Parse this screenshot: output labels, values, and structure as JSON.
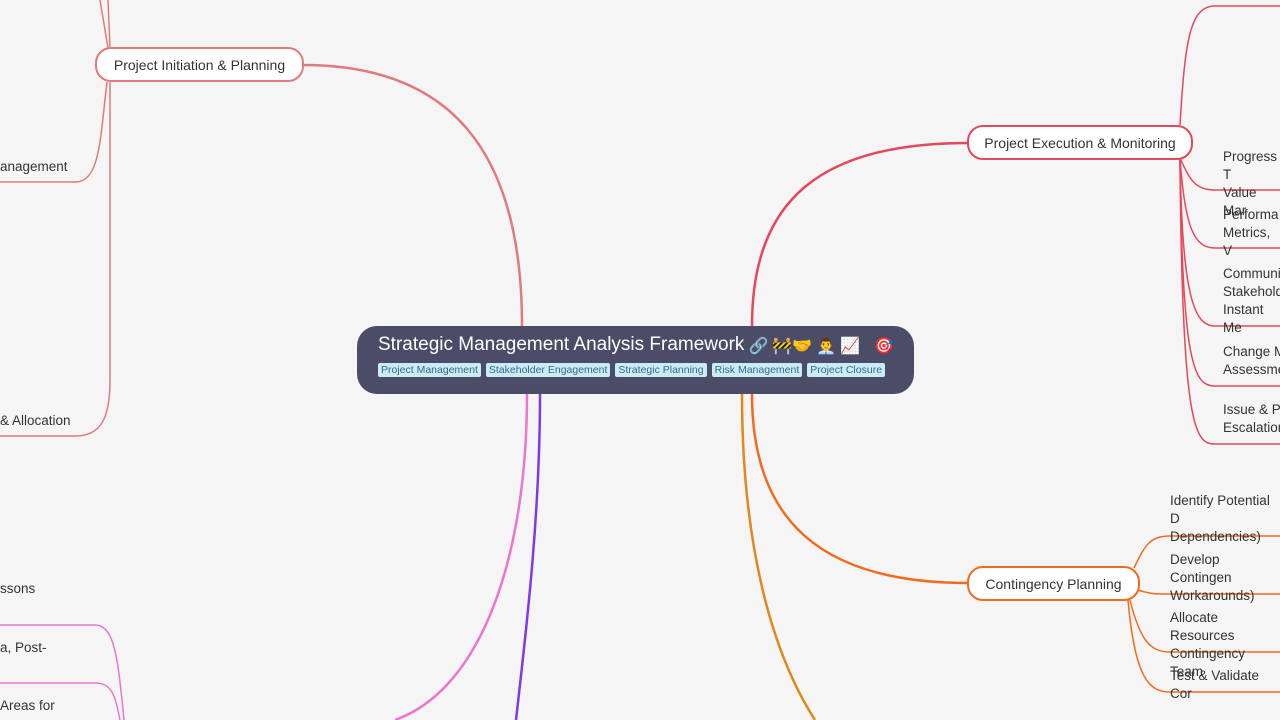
{
  "root": {
    "title": "Strategic Management Analysis Framework",
    "icons": [
      {
        "name": "link-icon",
        "glyph": "🔗"
      },
      {
        "name": "construction-icon",
        "glyph": "🚧"
      },
      {
        "name": "handshake-icon",
        "glyph": "🤝"
      },
      {
        "name": "businessman-icon",
        "glyph": "👨‍💼"
      },
      {
        "name": "chart-increasing-icon",
        "glyph": "📈"
      },
      {
        "name": "target-icon",
        "glyph": "🎯"
      }
    ],
    "tags": [
      "Project Management",
      "Stakeholder Engagement",
      "Strategic Planning",
      "Risk Management",
      "Project Closure"
    ]
  },
  "branches": {
    "initiation": {
      "label": "Project Initiation & Planning",
      "color": "#e07b7b",
      "leaves": [
        "anagement",
        "& Allocation"
      ]
    },
    "execution": {
      "label": "Project Execution & Monitoring",
      "color": "#e5485a",
      "leaves": [
        "Progress T\nValue Mar",
        "Performa\nMetrics, V",
        "Communi\nStakehold\nInstant Me",
        "Change M\nAssessme",
        "Issue & Pr\nEscalation"
      ]
    },
    "contingency": {
      "label": "Contingency Planning",
      "color": "#f26b1d",
      "leaves": [
        "Identify Potential D\nDependencies)",
        "Develop Contingen\nWorkarounds)",
        "Allocate Resources\nContingency Team",
        "Test & Validate Cor"
      ]
    },
    "closure": {
      "color": "#ea76cf",
      "leaves": [
        "ssons",
        "a, Post-",
        " Areas for"
      ]
    },
    "purple": {
      "color": "#7c3aed"
    },
    "amber": {
      "color": "#e0891a"
    }
  }
}
